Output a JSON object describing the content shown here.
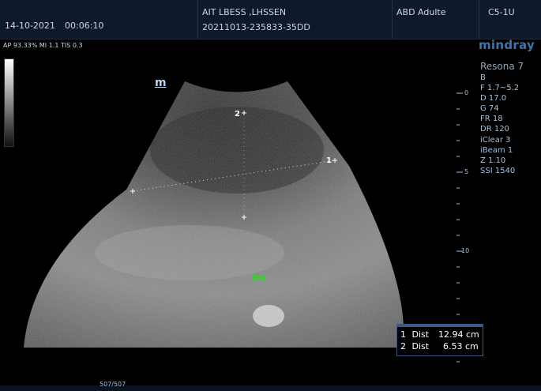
{
  "header": {
    "date": "14-10-2021",
    "time": "00:06:10",
    "patient_name": "AIT LBESS ,LHSSEN",
    "exam_id": "20211013-235833-35DD",
    "preset": "ABD Adulte",
    "probe": "C5-1U"
  },
  "acoustic": {
    "text": "AP 93.33%  MI 1.1 TIS 0.3"
  },
  "brand": {
    "logo": "mindray",
    "model": "Resona 7"
  },
  "image_params": [
    "B",
    "F 1.7~5.2",
    "D 17.0",
    "G 74",
    "FR 18",
    "DR 120",
    "iClear 3",
    "iBeam 1",
    "Z 1.10",
    "SSI 1540"
  ],
  "mark": "m",
  "depth_scale": {
    "labels": [
      "0",
      "5",
      "10"
    ]
  },
  "measurements": [
    {
      "index": "1",
      "label": "Dist",
      "value": "12.94 cm"
    },
    {
      "index": "2",
      "label": "Dist",
      "value": "6.53 cm"
    }
  ],
  "caliper_labels": [
    "1",
    "2"
  ],
  "annotation": "RK",
  "cine": {
    "frame": "507/507"
  }
}
